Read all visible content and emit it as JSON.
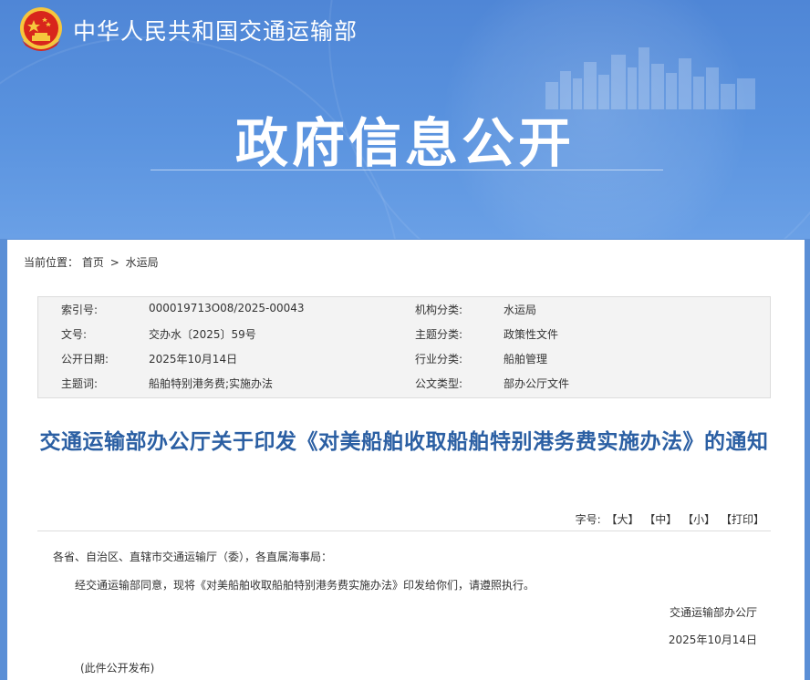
{
  "header": {
    "ministry_name": "中华人民共和国交通运输部",
    "section_title": "政府信息公开"
  },
  "breadcrumb": {
    "label": "当前位置：",
    "items": [
      "首页",
      "水运局"
    ],
    "separator": ">"
  },
  "meta": {
    "rows": [
      {
        "label1": "索引号:",
        "value1": "000019713O08/2025-00043",
        "label2": "机构分类:",
        "value2": "水运局"
      },
      {
        "label1": "文号:",
        "value1": "交办水〔2025〕59号",
        "label2": "主题分类:",
        "value2": "政策性文件"
      },
      {
        "label1": "公开日期:",
        "value1": "2025年10月14日",
        "label2": "行业分类:",
        "value2": "船舶管理"
      },
      {
        "label1": "主题词:",
        "value1": "船舶特别港务费;实施办法",
        "label2": "公文类型:",
        "value2": "部办公厅文件"
      }
    ]
  },
  "document": {
    "title": "交通运输部办公厅关于印发《对美船舶收取船舶特别港务费实施办法》的通知",
    "font_size_label": "字号:",
    "font_size_large": "【大】",
    "font_size_medium": "【中】",
    "font_size_small": "【小】",
    "print": "【打印】",
    "salutation": "各省、自治区、直辖市交通运输厅（委），各直属海事局：",
    "paragraph": "经交通运输部同意，现将《对美船舶收取船舶特别港务费实施办法》印发给你们，请遵照执行。",
    "signer": "交通运输部办公厅",
    "date": "2025年10月14日",
    "publish_note": "(此件公开发布)"
  },
  "colors": {
    "banner_blue": "#4f86d6",
    "title_blue": "#2b5fa3",
    "emblem_red": "#d8261c",
    "emblem_gold": "#f6c63d"
  }
}
